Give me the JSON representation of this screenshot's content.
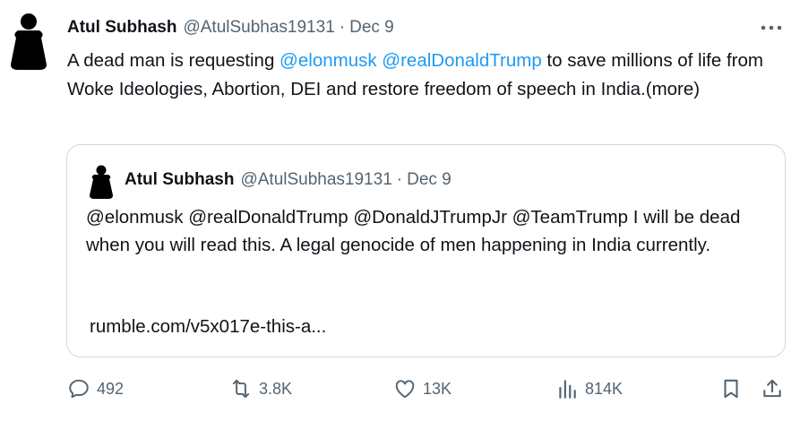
{
  "author": {
    "name": "Atul Subhash",
    "handle": "@AtulSubhas19131",
    "separator": "·",
    "date": "Dec 9"
  },
  "tweet": {
    "text_before": "A dead man is requesting ",
    "mention_1": "@elonmusk",
    "space": " ",
    "mention_2": "@realDonaldTrump",
    "text_after": "  to save millions of life from Woke Ideologies, Abortion, DEI and restore freedom of speech in India.",
    "show_more": "(more)"
  },
  "quote": {
    "name": "Atul Subhash",
    "handle": "@AtulSubhas19131",
    "separator": "·",
    "date": "Dec 9",
    "text": "@elonmusk  @realDonaldTrump @DonaldJTrumpJr @TeamTrump I will be dead when you will read this. A legal genocide of men happening in India currently.",
    "link": "rumble.com/v5x017e-this-a..."
  },
  "actions": {
    "replies": "492",
    "reposts": "3.8K",
    "likes": "13K",
    "views": "814K"
  },
  "icons": {
    "reply": "reply-icon",
    "repost": "repost-icon",
    "like": "heart-icon",
    "views": "views-icon",
    "bookmark": "bookmark-icon",
    "share": "share-icon",
    "more": "more-icon"
  },
  "colors": {
    "text": "#0f1419",
    "secondary": "#536471",
    "accent": "#1d9bf0",
    "border": "#cfd9de"
  }
}
